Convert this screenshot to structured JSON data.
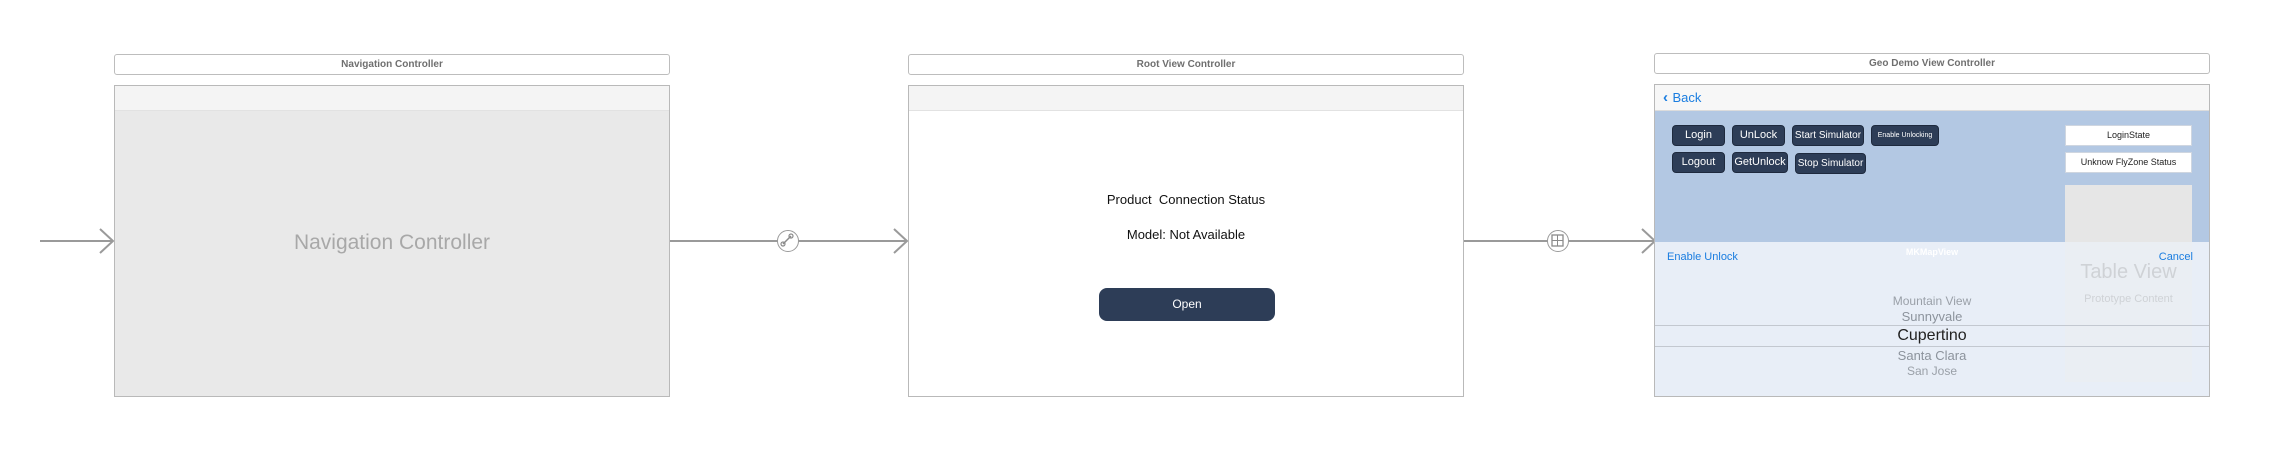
{
  "nav_scene": {
    "title": "Navigation Controller",
    "placeholder": "Navigation Controller"
  },
  "root_scene": {
    "title": "Root View Controller",
    "status_label": "Product  Connection Status",
    "model_label": "Model: Not Available",
    "open_button": "Open"
  },
  "geo_scene": {
    "title": "Geo Demo View Controller",
    "back_label": "Back",
    "buttons_row1": [
      "Login",
      "UnLock",
      "Start Simulator",
      "Enable Unlocking"
    ],
    "buttons_row2": [
      "Logout",
      "GetUnlock",
      "Stop Simulator"
    ],
    "login_state": "LoginState",
    "flyzone_status": "Unknow FlyZone Status",
    "map_label": "MKMapView",
    "enable_unlock": "Enable Unlock",
    "cancel": "Cancel",
    "table_view": "Table View",
    "prototype_content": "Prototype Content",
    "picker_items": [
      "Mountain View",
      "Sunnyvale",
      "Cupertino",
      "Santa Clara",
      "San Jose"
    ]
  },
  "colors": {
    "dark_button": "#2d3d57",
    "link_blue": "#1a7de0",
    "map_blue": "#b3c8e3",
    "canvas_grey": "#e9e9e9"
  }
}
